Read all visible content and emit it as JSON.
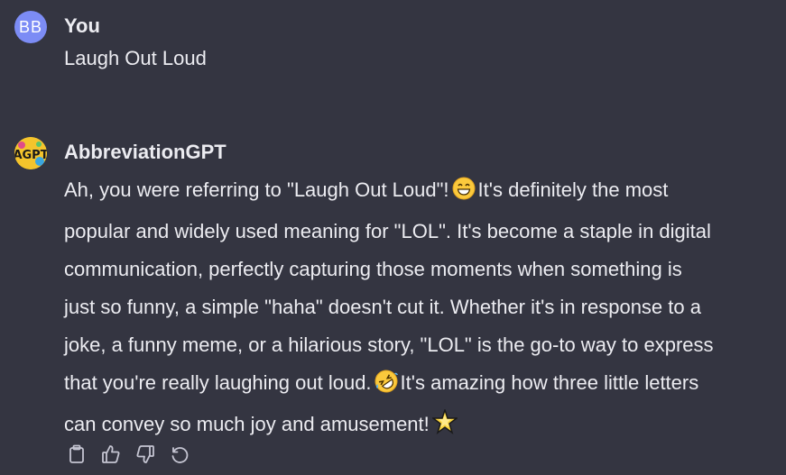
{
  "user_message": {
    "avatar_initials": "BB",
    "author": "You",
    "text": "Laugh Out Loud"
  },
  "bot_message": {
    "avatar_icon": "agpt-logo-icon",
    "author": "AbbreviationGPT",
    "lines": [
      {
        "before": "Ah, you were referring to \"Laugh Out Loud\"!",
        "emoji": "grinning-face-icon",
        "after": "It's definitely the most"
      },
      {
        "text": "popular and widely used meaning for \"LOL\". It's become a staple in digital"
      },
      {
        "text": "communication, perfectly capturing those moments when something is"
      },
      {
        "text": "just so funny, a simple \"haha\" doesn't cut it. Whether it's in response to a"
      },
      {
        "text": "joke, a funny meme, or a hilarious story, \"LOL\" is the go-to way to express"
      },
      {
        "before": "that you're really laughing out loud.",
        "emoji": "rolling-on-floor-laughing-icon",
        "after": "It's amazing how three little letters"
      },
      {
        "before": "can convey so much joy and amusement!",
        "emoji": "star-icon"
      }
    ]
  },
  "actions": [
    {
      "name": "copy-button",
      "icon": "clipboard-icon"
    },
    {
      "name": "thumbs-up-button",
      "icon": "thumbs-up-icon"
    },
    {
      "name": "thumbs-down-button",
      "icon": "thumbs-down-icon"
    },
    {
      "name": "regenerate-button",
      "icon": "regenerate-icon"
    }
  ],
  "colors": {
    "background": "#343541",
    "text": "#ececf1",
    "user_avatar": "#7c8cf5",
    "bot_avatar": "#f4c42c",
    "icon": "#c5c5d2"
  }
}
